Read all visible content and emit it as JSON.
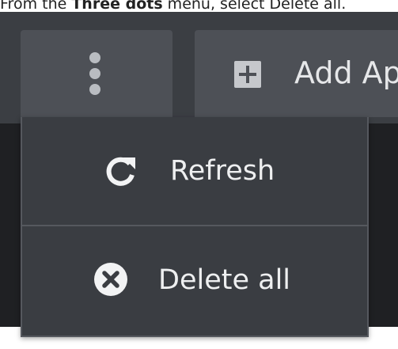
{
  "caption": {
    "prefix": "From the ",
    "emphasis": "Three dots",
    "suffix": " menu, select Delete all."
  },
  "toolbar": {
    "add_label": "Add Ap",
    "add_icon": "plus-square-icon",
    "menu_icon": "kebab-vertical-icon"
  },
  "menu": {
    "items": [
      {
        "label": "Refresh",
        "icon": "refresh-icon"
      },
      {
        "label": "Delete all",
        "icon": "delete-circle-x-icon"
      }
    ]
  },
  "colors": {
    "toolbar_bg": "#3b3e43",
    "button_bg": "#4d5056",
    "menu_bg": "#3a3d42",
    "menu_border": "#55585e",
    "text": "#eeeff0"
  }
}
